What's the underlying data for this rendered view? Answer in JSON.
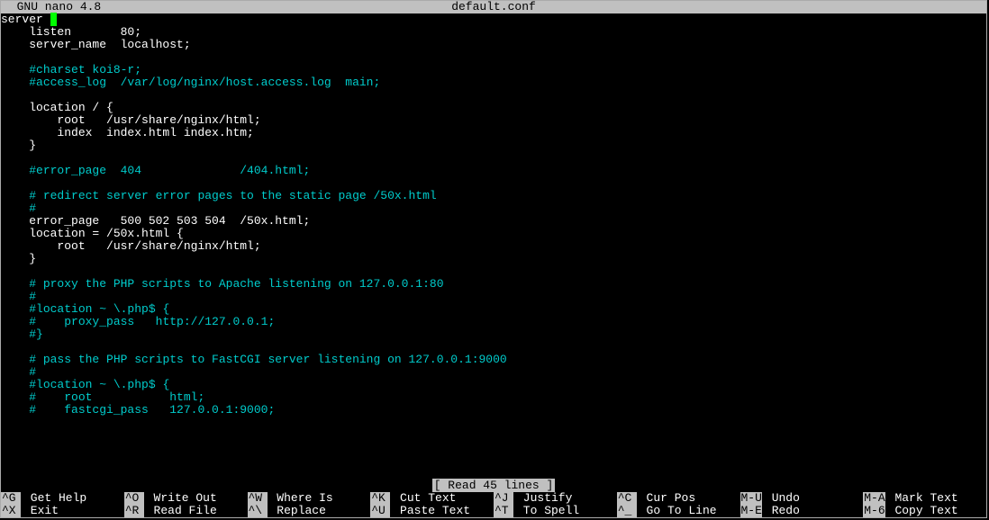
{
  "titlebar": {
    "app": "  GNU nano 4.8",
    "filename": "default.conf"
  },
  "editor": {
    "lines": [
      {
        "segments": [
          {
            "t": "server "
          },
          {
            "t": "{",
            "cursor": true
          }
        ]
      },
      {
        "segments": [
          {
            "t": "    listen       80;"
          }
        ]
      },
      {
        "segments": [
          {
            "t": "    server_name  localhost;"
          }
        ]
      },
      {
        "segments": [
          {
            "t": ""
          }
        ]
      },
      {
        "segments": [
          {
            "t": "    "
          },
          {
            "t": "#charset koi8-r;",
            "c": true
          }
        ]
      },
      {
        "segments": [
          {
            "t": "    "
          },
          {
            "t": "#access_log  /var/log/nginx/host.access.log  main;",
            "c": true
          }
        ]
      },
      {
        "segments": [
          {
            "t": ""
          }
        ]
      },
      {
        "segments": [
          {
            "t": "    location / {"
          }
        ]
      },
      {
        "segments": [
          {
            "t": "        root   /usr/share/nginx/html;"
          }
        ]
      },
      {
        "segments": [
          {
            "t": "        index  index.html index.htm;"
          }
        ]
      },
      {
        "segments": [
          {
            "t": "    }"
          }
        ]
      },
      {
        "segments": [
          {
            "t": ""
          }
        ]
      },
      {
        "segments": [
          {
            "t": "    "
          },
          {
            "t": "#error_page  404              /404.html;",
            "c": true
          }
        ]
      },
      {
        "segments": [
          {
            "t": ""
          }
        ]
      },
      {
        "segments": [
          {
            "t": "    "
          },
          {
            "t": "# redirect server error pages to the static page /50x.html",
            "c": true
          }
        ]
      },
      {
        "segments": [
          {
            "t": "    "
          },
          {
            "t": "#",
            "c": true
          }
        ]
      },
      {
        "segments": [
          {
            "t": "    error_page   500 502 503 504  /50x.html;"
          }
        ]
      },
      {
        "segments": [
          {
            "t": "    location = /50x.html {"
          }
        ]
      },
      {
        "segments": [
          {
            "t": "        root   /usr/share/nginx/html;"
          }
        ]
      },
      {
        "segments": [
          {
            "t": "    }"
          }
        ]
      },
      {
        "segments": [
          {
            "t": ""
          }
        ]
      },
      {
        "segments": [
          {
            "t": "    "
          },
          {
            "t": "# proxy the PHP scripts to Apache listening on 127.0.0.1:80",
            "c": true
          }
        ]
      },
      {
        "segments": [
          {
            "t": "    "
          },
          {
            "t": "#",
            "c": true
          }
        ]
      },
      {
        "segments": [
          {
            "t": "    "
          },
          {
            "t": "#location ~ \\.php$ {",
            "c": true
          }
        ]
      },
      {
        "segments": [
          {
            "t": "    "
          },
          {
            "t": "#    proxy_pass   http://127.0.0.1;",
            "c": true
          }
        ]
      },
      {
        "segments": [
          {
            "t": "    "
          },
          {
            "t": "#}",
            "c": true
          }
        ]
      },
      {
        "segments": [
          {
            "t": ""
          }
        ]
      },
      {
        "segments": [
          {
            "t": "    "
          },
          {
            "t": "# pass the PHP scripts to FastCGI server listening on 127.0.0.1:9000",
            "c": true
          }
        ]
      },
      {
        "segments": [
          {
            "t": "    "
          },
          {
            "t": "#",
            "c": true
          }
        ]
      },
      {
        "segments": [
          {
            "t": "    "
          },
          {
            "t": "#location ~ \\.php$ {",
            "c": true
          }
        ]
      },
      {
        "segments": [
          {
            "t": "    "
          },
          {
            "t": "#    root           html;",
            "c": true
          }
        ]
      },
      {
        "segments": [
          {
            "t": "    "
          },
          {
            "t": "#    fastcgi_pass   127.0.0.1:9000;",
            "c": true
          }
        ]
      }
    ]
  },
  "status": "[ Read 45 lines ]",
  "shortcuts": {
    "row1": [
      {
        "key": "^G",
        "label": "Get Help"
      },
      {
        "key": "^O",
        "label": "Write Out"
      },
      {
        "key": "^W",
        "label": "Where Is"
      },
      {
        "key": "^K",
        "label": "Cut Text"
      },
      {
        "key": "^J",
        "label": "Justify"
      },
      {
        "key": "^C",
        "label": "Cur Pos"
      },
      {
        "key": "M-U",
        "label": "Undo"
      },
      {
        "key": "M-A",
        "label": "Mark Text"
      }
    ],
    "row2": [
      {
        "key": "^X",
        "label": "Exit"
      },
      {
        "key": "^R",
        "label": "Read File"
      },
      {
        "key": "^\\",
        "label": "Replace"
      },
      {
        "key": "^U",
        "label": "Paste Text"
      },
      {
        "key": "^T",
        "label": "To Spell"
      },
      {
        "key": "^_",
        "label": "Go To Line"
      },
      {
        "key": "M-E",
        "label": "Redo"
      },
      {
        "key": "M-6",
        "label": "Copy Text"
      }
    ]
  }
}
